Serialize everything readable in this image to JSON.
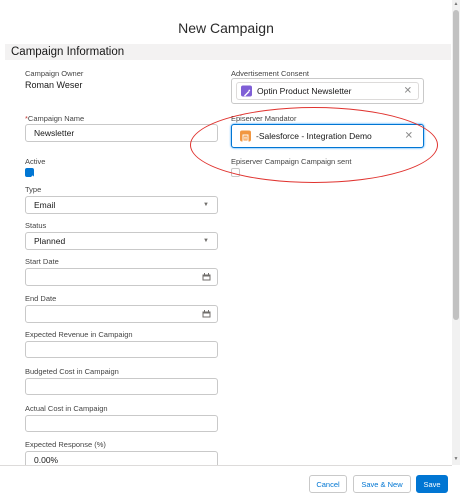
{
  "modal": {
    "title": "New Campaign"
  },
  "section": {
    "title": "Campaign Information"
  },
  "owner": {
    "label": "Campaign Owner",
    "value": "Roman Weser"
  },
  "ad_consent": {
    "label": "Advertisement Consent",
    "value": "Optin Product Newsletter",
    "icon": "newsletter-icon",
    "icon_color": "#7f5fd6"
  },
  "campaign_name": {
    "required_mark": "*",
    "label": "Campaign Name",
    "value": "Newsletter"
  },
  "episerver_mandator": {
    "label": "Episerver Mandator",
    "value": "-Salesforce - Integration Demo",
    "icon": "mandator-icon",
    "icon_color": "#f19742"
  },
  "active": {
    "label": "Active",
    "checked": true
  },
  "campaign_sent": {
    "label": "Episerver Campaign  Campaign sent",
    "checked": false
  },
  "type": {
    "label": "Type",
    "value": "Email"
  },
  "status": {
    "label": "Status",
    "value": "Planned"
  },
  "start_date": {
    "label": "Start Date",
    "value": ""
  },
  "end_date": {
    "label": "End Date",
    "value": ""
  },
  "expected_revenue": {
    "label": "Expected Revenue in Campaign",
    "value": ""
  },
  "budgeted_cost": {
    "label": "Budgeted Cost in Campaign",
    "value": ""
  },
  "actual_cost": {
    "label": "Actual Cost in Campaign",
    "value": ""
  },
  "expected_response": {
    "label": "Expected Response (%)",
    "value": "0.00%"
  },
  "footer": {
    "cancel": "Cancel",
    "save_new": "Save & New",
    "save": "Save"
  },
  "colors": {
    "brand": "#0176d3",
    "annotation": "#e0332f"
  }
}
